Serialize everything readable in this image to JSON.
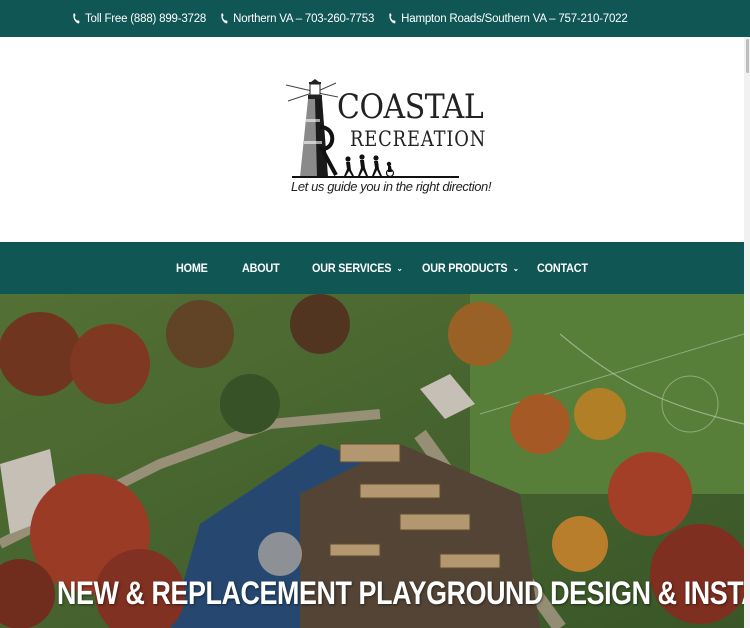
{
  "topbar": {
    "contacts": [
      {
        "label": "Toll Free (888) 899-3728",
        "icon": "phone-icon"
      },
      {
        "label": "Northern VA – 703-260-7753",
        "icon": "phone-icon"
      },
      {
        "label": "Hampton Roads/Southern VA – 757-210-7022",
        "icon": "phone-icon"
      }
    ]
  },
  "logo": {
    "word1": "COASTAL",
    "word2": "RECREATION",
    "tagline": "Let us guide you in the right direction!"
  },
  "nav": {
    "items": [
      {
        "label": "HOME"
      },
      {
        "label": "ABOUT"
      },
      {
        "label": "OUR SERVICES",
        "dropdown": true
      },
      {
        "label": "OUR PRODUCTS",
        "dropdown": true
      },
      {
        "label": "CONTACT"
      }
    ],
    "chevron": "⌄"
  },
  "hero": {
    "title": "NEW & REPLACEMENT PLAYGROUND DESIGN & INSTALLATION"
  },
  "colors": {
    "brand_teal": "#0f5655",
    "white": "#ffffff"
  }
}
